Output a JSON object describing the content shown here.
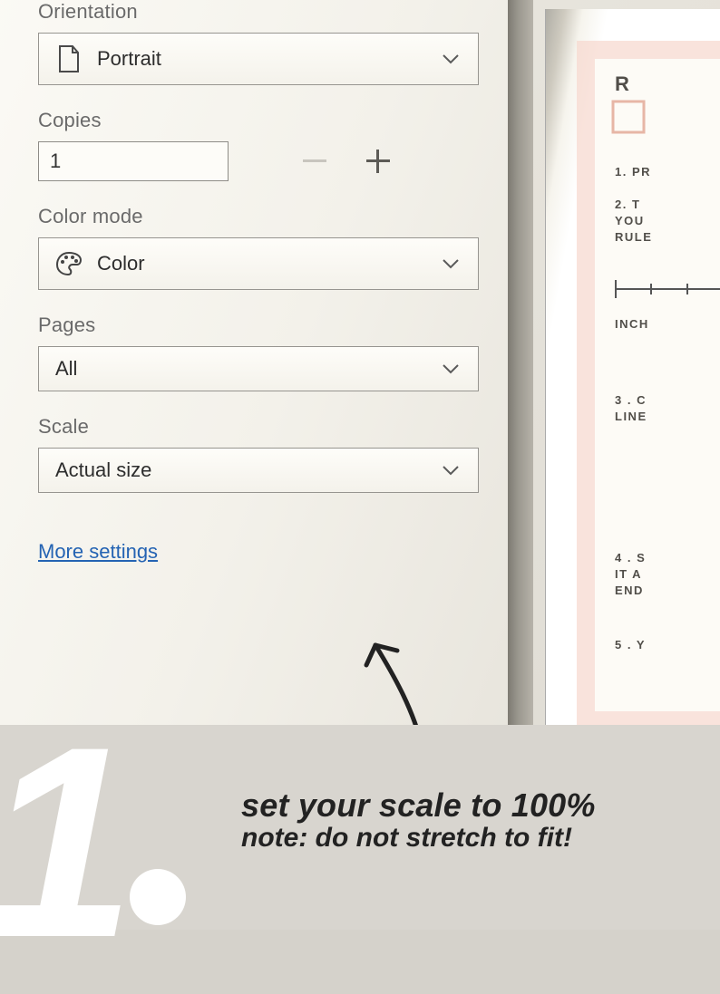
{
  "panel": {
    "orientation": {
      "label": "Orientation",
      "value": "Portrait"
    },
    "copies": {
      "label": "Copies",
      "value": "1"
    },
    "color_mode": {
      "label": "Color mode",
      "value": "Color"
    },
    "pages": {
      "label": "Pages",
      "value": "All"
    },
    "scale": {
      "label": "Scale",
      "value": "Actual size"
    },
    "more_settings": "More settings"
  },
  "preview": {
    "heading": "R",
    "line1": "1. PR",
    "line2a": "2. T",
    "line2b": "YOU",
    "line2c": "RULE",
    "inch": "INCH",
    "line3a": "3 .  C",
    "line3b": "LINE",
    "line4a": "4 .  S",
    "line4b": "IT  A",
    "line4c": "END",
    "line5": "5 .  Y"
  },
  "annotation": {
    "step_number": "1",
    "line1": "set your scale to 100%",
    "line2": "note: do not stretch to fit!"
  }
}
